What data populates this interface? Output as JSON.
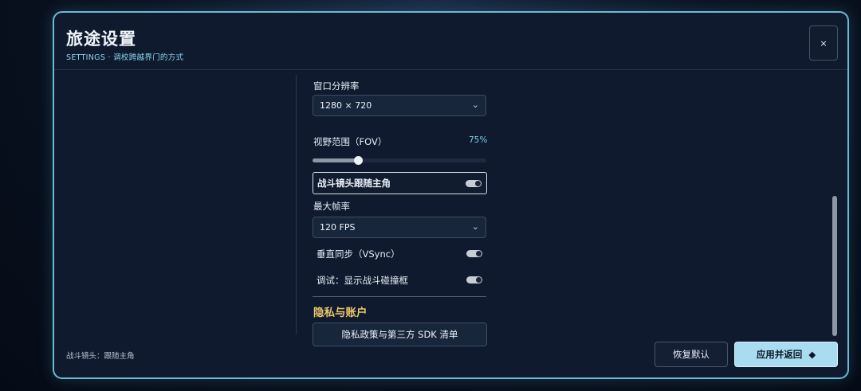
{
  "header": {
    "title": "旅途设置",
    "subtitle": "SETTINGS · 调校跨越界门的方式",
    "close_label": "×"
  },
  "settings": {
    "resolution": {
      "label": "窗口分辨率",
      "value": "1280 × 720",
      "chevron": "⌄"
    },
    "fov": {
      "label": "视野范围（FOV）",
      "value": "75%",
      "level": 0.26
    },
    "camera_follow": {
      "label": "战斗镜头跟随主角",
      "on": true
    },
    "max_fps": {
      "label": "最大帧率",
      "value": "120 FPS",
      "chevron": "⌄"
    },
    "vsync": {
      "label": "垂直同步（VSync）",
      "on": true
    },
    "debug_hitbox": {
      "label": "调试：显示战斗碰撞框",
      "on": true
    }
  },
  "privacy": {
    "section_title": "隐私与账户",
    "policy_button": "隐私政策与第三方 SDK 清单"
  },
  "footer": {
    "status": "战斗镜头：跟随主角",
    "reset_label": "恢复默认",
    "apply_label": "应用并返回",
    "apply_icon": "◆"
  },
  "colors": {
    "accent": "#7dcfe8",
    "section_title": "#e9c76b",
    "apply_button": "#a9dcf0"
  }
}
